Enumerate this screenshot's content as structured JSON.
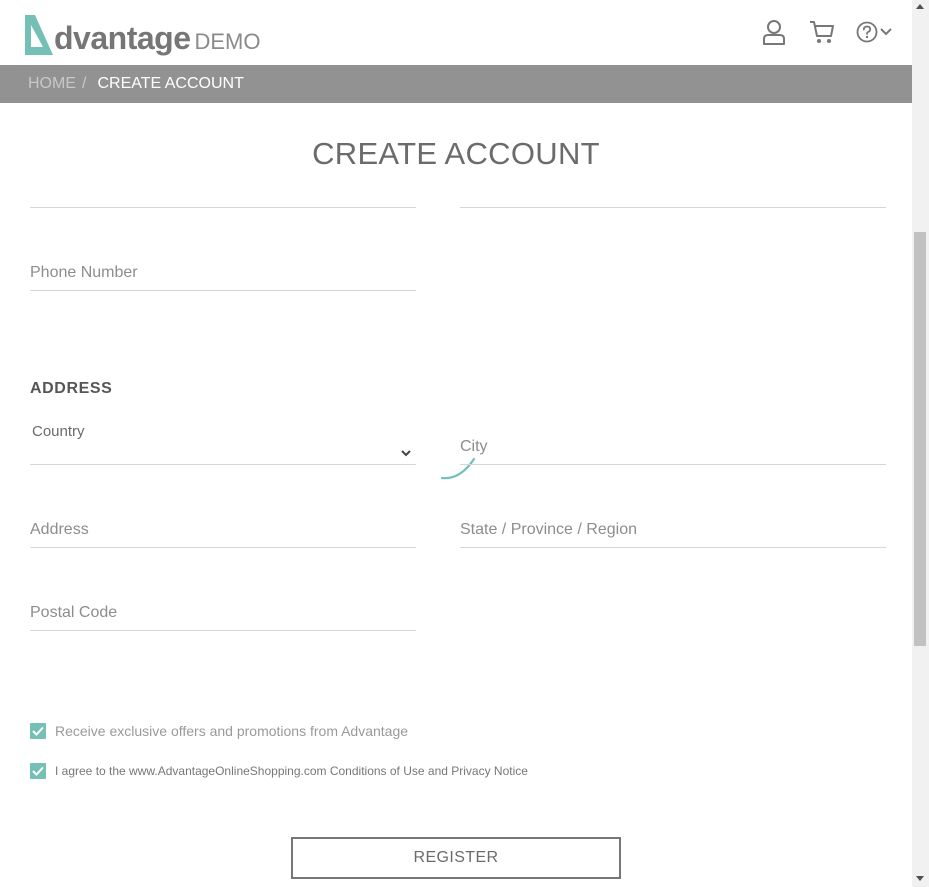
{
  "header": {
    "logo_text": "dvantage",
    "logo_demo": "DEMO",
    "icons": [
      "user-icon",
      "cart-icon",
      "help-icon",
      "chevron-down-icon"
    ]
  },
  "breadcrumb": {
    "home": "HOME",
    "separator": "/",
    "current": "CREATE ACCOUNT"
  },
  "page": {
    "title": "CREATE ACCOUNT"
  },
  "form": {
    "phone_placeholder": "Phone Number",
    "address_section": "ADDRESS",
    "country_label": "Country",
    "city_placeholder": "City",
    "address_placeholder": "Address",
    "state_placeholder": "State / Province / Region",
    "postal_placeholder": "Postal Code",
    "offers_label": "Receive exclusive offers and promotions from Advantage",
    "offers_checked": true,
    "agree_label": "I agree to the www.AdvantageOnlineShopping.com Conditions of Use and Privacy Notice",
    "agree_checked": true,
    "register_label": "REGISTER"
  },
  "colors": {
    "accent": "#74c0b6",
    "breadcrumb_bg": "#929292",
    "text": "#6b6b6b"
  }
}
